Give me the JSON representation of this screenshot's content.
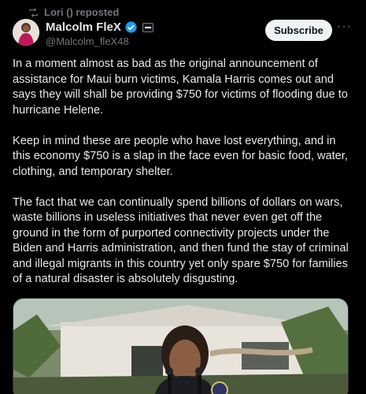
{
  "repost": {
    "icon": "repost-icon",
    "text": "Lori ()⁠ reposted"
  },
  "author": {
    "display_name": "Malcolm FleX",
    "handle": "@Malcolm_fleX48",
    "verified_icon": "verified-badge-icon",
    "affiliate_icon": "affiliate-badge-icon"
  },
  "actions": {
    "subscribe_label": "Subscribe",
    "more_icon": "more-icon"
  },
  "tweet": {
    "text": "In a moment almost as bad as the original announcement of assistance for Maui burn victims, Kamala Harris comes out and says they will shall be providing $750 for victims of flooding due to hurricane Helene.\n\nKeep in mind these are people who have lost everything, and in this economy $750 is a slap in the face even for basic food, water, clothing, and temporary shelter.\n\nThe fact that we can continually spend billions of dollars on wars, waste billions in useless initiatives that never even get off the ground in the form of purported connectivity projects under the Biden and Harris administration, and then fund the stay of criminal and illegal migrants in this country yet only spare $750 for families of a natural disaster is absolutely disgusting."
  },
  "colors": {
    "background": "#000000",
    "text": "#e7e9ea",
    "muted": "#71767b",
    "verified": "#1d9bf0",
    "button_bg": "#eff3f4"
  }
}
